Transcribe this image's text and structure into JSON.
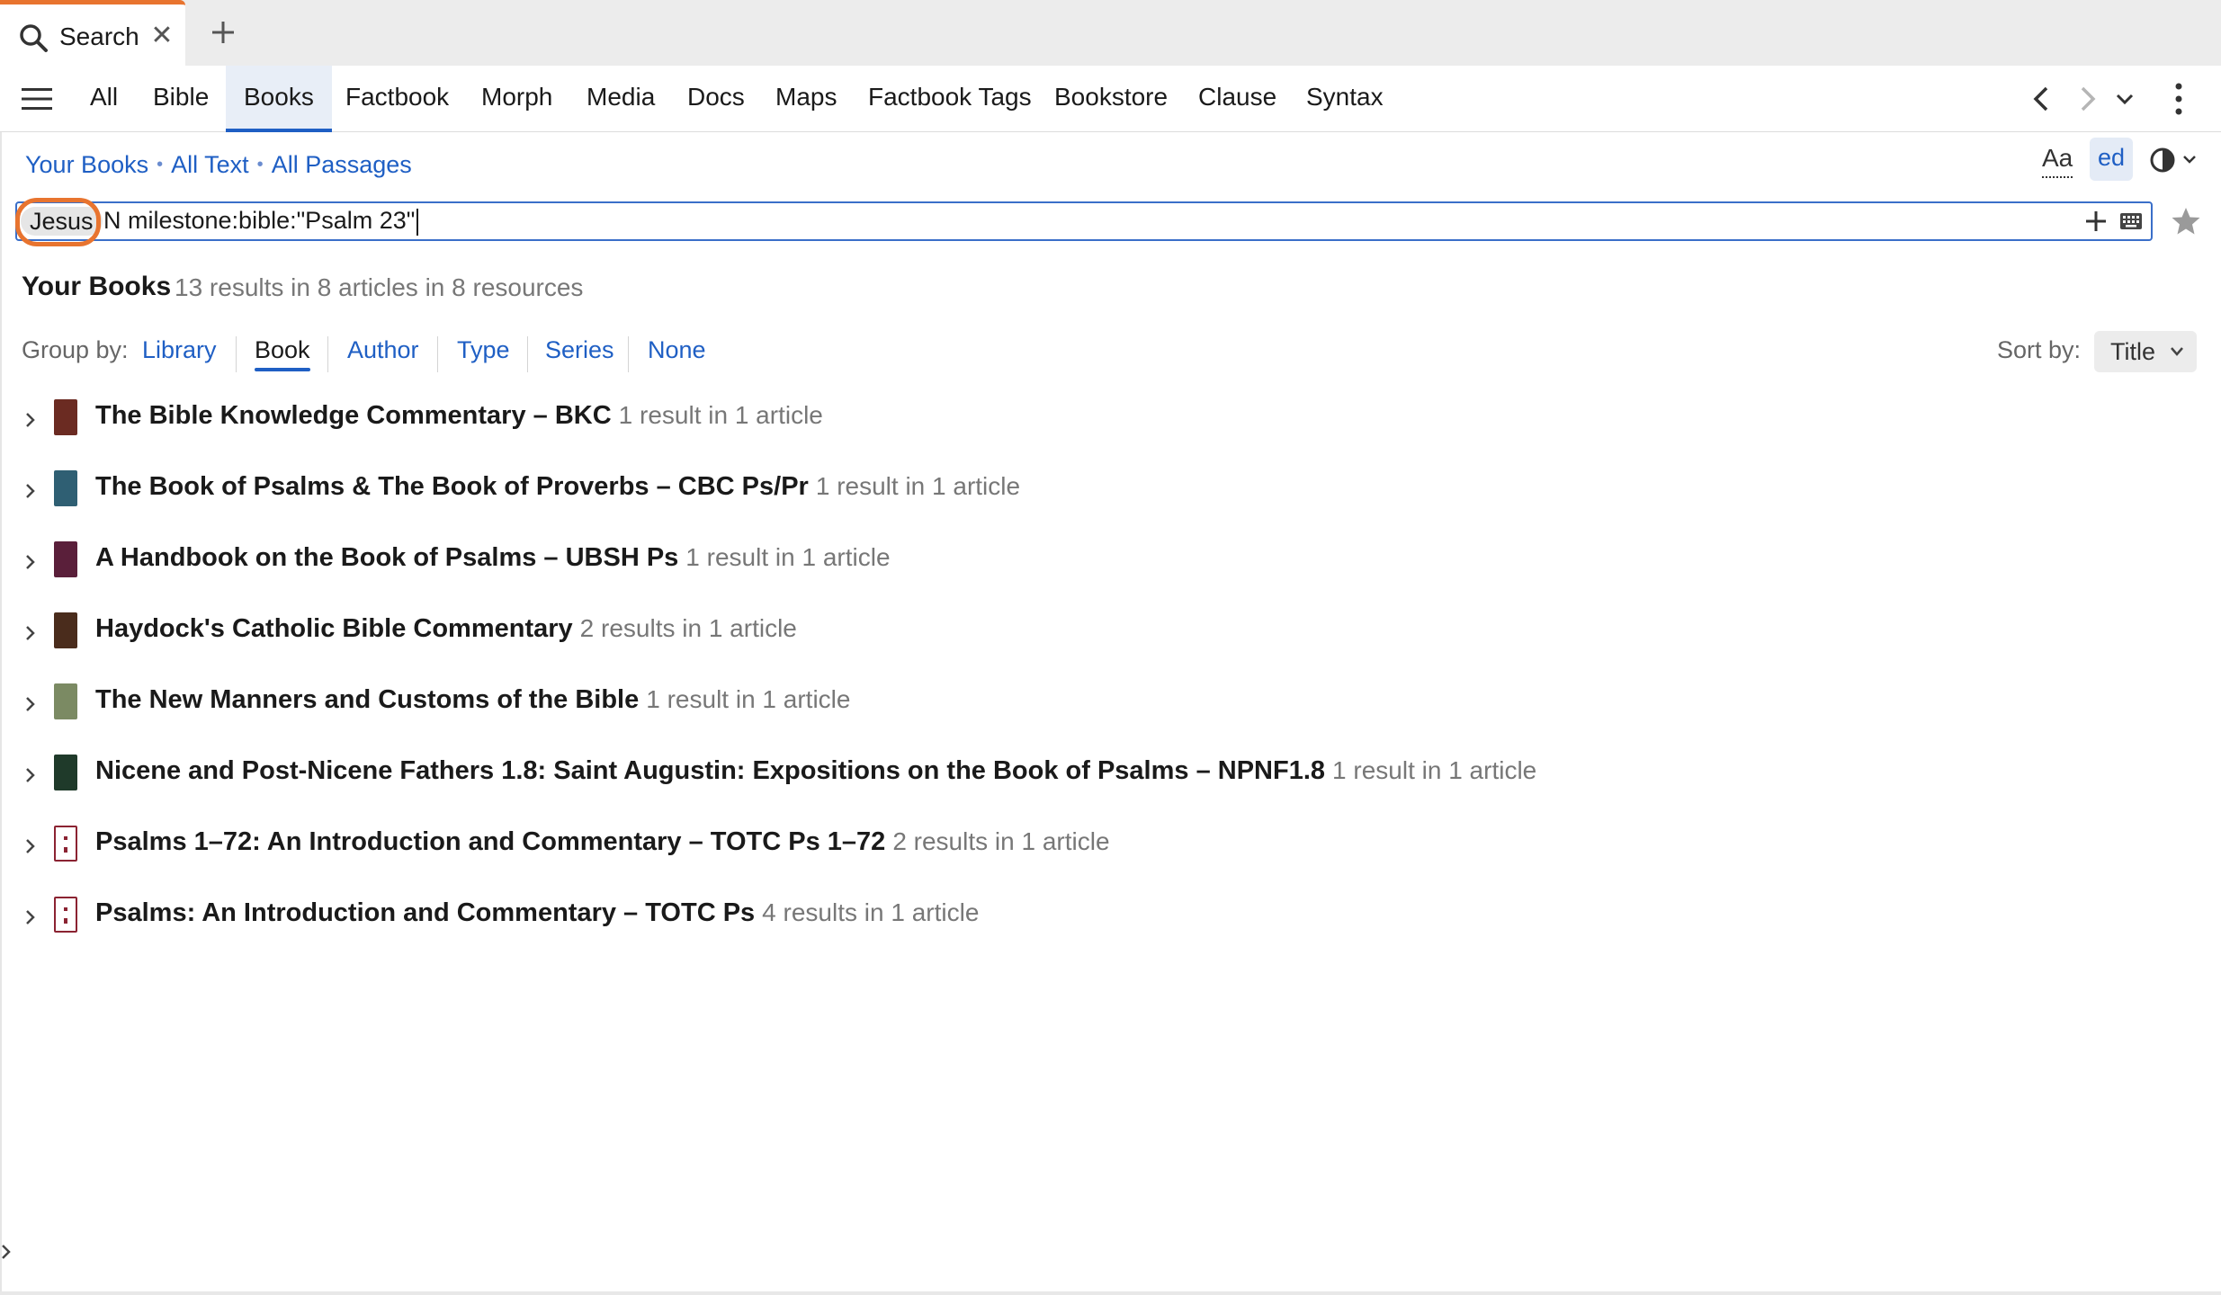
{
  "window_tab": {
    "title": "Search",
    "close_label": "✕"
  },
  "category_tabs": [
    "All",
    "Bible",
    "Books",
    "Factbook",
    "Morph",
    "Media",
    "Docs",
    "Maps",
    "Factbook Tags",
    "Bookstore",
    "Clause",
    "Syntax"
  ],
  "active_category": "Books",
  "scope": {
    "items": [
      "Your Books",
      "All Text",
      "All Passages"
    ],
    "separator": "•"
  },
  "toolbar": {
    "font_label": "Aa",
    "ed_label": "ed"
  },
  "search": {
    "token": "Jesus",
    "query": "N milestone:bible:\"Psalm 23\""
  },
  "results": {
    "title": "Your Books",
    "summary": "13 results in 8 articles in 8 resources"
  },
  "groupby": {
    "label": "Group by:",
    "options": [
      "Library",
      "Book",
      "Author",
      "Type",
      "Series",
      "None"
    ],
    "active": "Book"
  },
  "sortby": {
    "label": "Sort by:",
    "value": "Title"
  },
  "books": [
    {
      "title": "The Bible Knowledge Commentary – BKC",
      "count": "1 result in 1 article",
      "cover_color": "#6b2b22"
    },
    {
      "title": "The Book of Psalms & The Book of Proverbs – CBC Ps/Pr",
      "count": "1 result in 1 article",
      "cover_color": "#2f5f73"
    },
    {
      "title": "A Handbook on the Book of Psalms – UBSH Ps",
      "count": "1 result in 1 article",
      "cover_color": "#5a1f3a"
    },
    {
      "title": "Haydock's Catholic Bible Commentary",
      "count": "2 results in 1 article",
      "cover_color": "#4a2c1c"
    },
    {
      "title": "The New Manners and Customs of the Bible",
      "count": "1 result in 1 article",
      "cover_color": "#7b8a63"
    },
    {
      "title": "Nicene and Post-Nicene Fathers 1.8: Saint Augustin: Expositions on the Book of Psalms – NPNF1.8",
      "count": "1 result in 1 article",
      "cover_color": "#1f3a2a"
    },
    {
      "title": "Psalms 1–72: An Introduction and Commentary – TOTC Ps 1–72",
      "count": "2 results in 1 article",
      "cover_color": "#8b2332"
    },
    {
      "title": "Psalms: An Introduction and Commentary – TOTC Ps",
      "count": "4 results in 1 article",
      "cover_color": "#8b2332"
    }
  ]
}
